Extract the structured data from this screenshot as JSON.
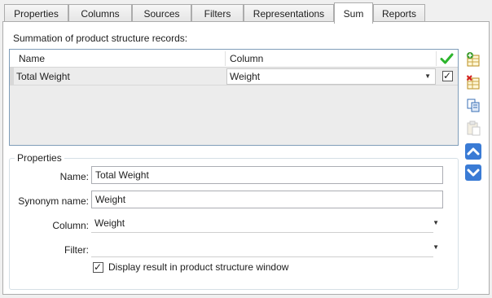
{
  "tabs": [
    {
      "label": "Properties",
      "active": false
    },
    {
      "label": "Columns",
      "active": false
    },
    {
      "label": "Sources",
      "active": false
    },
    {
      "label": "Filters",
      "active": false
    },
    {
      "label": "Representations",
      "active": false
    },
    {
      "label": "Sum",
      "active": true
    },
    {
      "label": "Reports",
      "active": false
    }
  ],
  "sum_panel": {
    "caption": "Summation of product structure records:",
    "grid": {
      "columns": [
        "Name",
        "Column"
      ],
      "rows": [
        {
          "name": "Total Weight",
          "column": "Weight",
          "checked": true
        }
      ]
    },
    "side_buttons": [
      "add-row-icon",
      "delete-row-icon",
      "copy-icon",
      "paste-icon",
      "move-up-icon",
      "move-down-icon"
    ]
  },
  "properties": {
    "legend": "Properties",
    "name_label": "Name:",
    "name_value": "Total Weight",
    "synonym_label": "Synonym name:",
    "synonym_value": "Weight",
    "column_label": "Column:",
    "column_value": "Weight",
    "filter_label": "Filter:",
    "filter_value": "",
    "display_result_label": "Display result in product structure window",
    "display_result_checked": true
  },
  "colors": {
    "accent_blue": "#3a7bd5",
    "check_green": "#2db52d",
    "add_green": "#3c9b2c",
    "delete_red": "#d42020"
  }
}
